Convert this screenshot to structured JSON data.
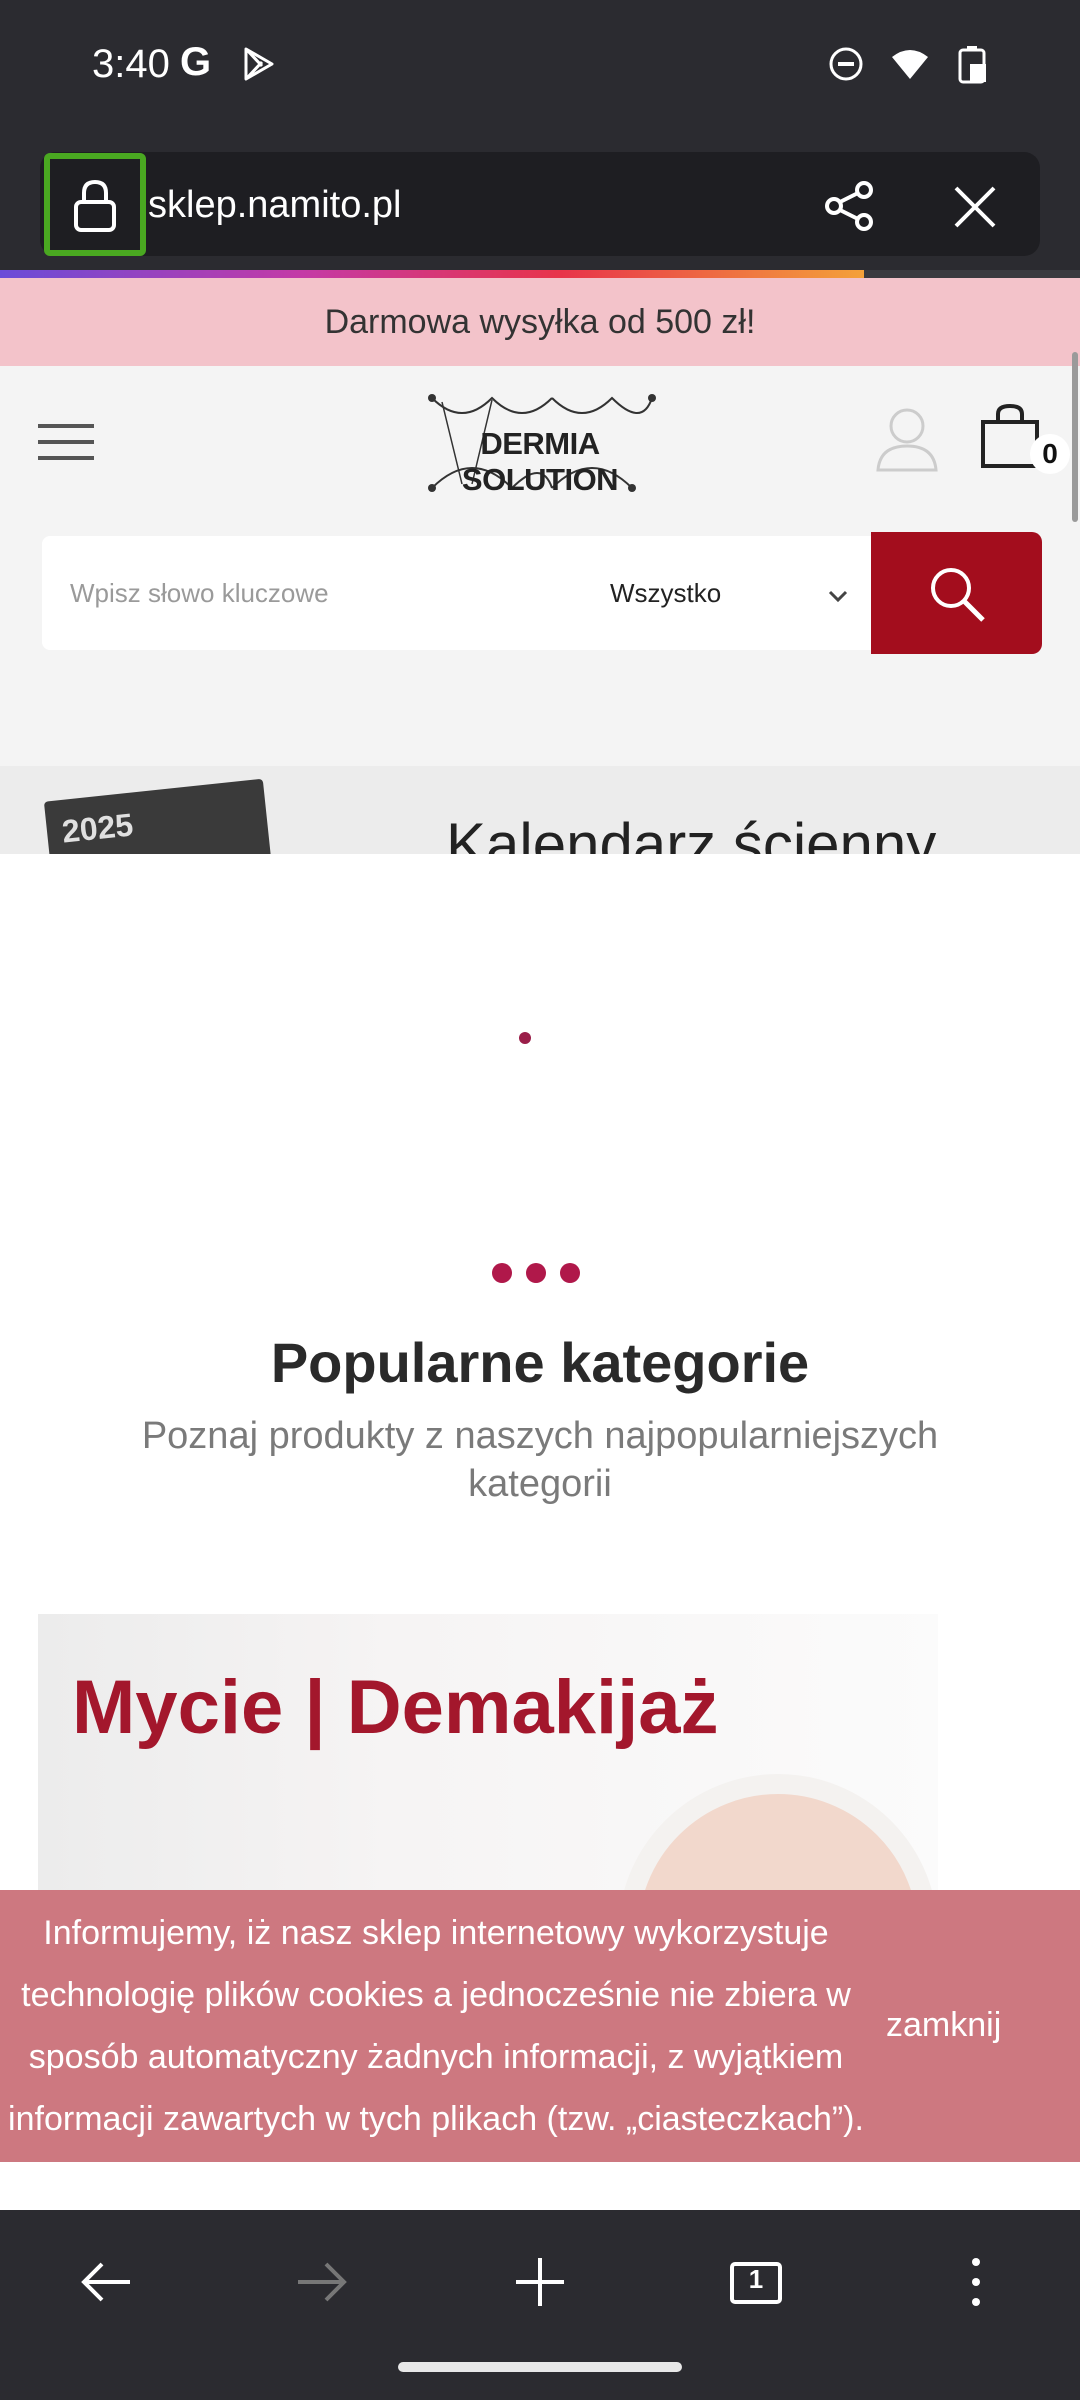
{
  "status_bar": {
    "time": "3:40",
    "g_logo": "G",
    "icons": [
      "google-icon",
      "play-store-icon",
      "dnd-icon",
      "wifi-icon",
      "battery-icon"
    ]
  },
  "browser": {
    "url": "sklep.namito.pl",
    "icons": [
      "lock-icon",
      "share-icon",
      "close-icon"
    ]
  },
  "page": {
    "promo": "Darmowa wysyłka od 500 zł!",
    "logo_text": "DERMIA SOLUTION",
    "cart_count": "0",
    "search": {
      "placeholder": "Wpisz słowo kluczowe",
      "category": "Wszystko"
    },
    "banner": {
      "year": "2025",
      "title": "Kalendarz ścienny"
    },
    "categories": {
      "title": "Popularne kategorie",
      "subtitle": "Poznaj produkty z naszych najpopularniejszych kategorii",
      "first_card_label": "Mycie | Demakijaż"
    },
    "cookie": {
      "text": "Informujemy, iż nasz sklep internetowy wykorzystuje technologię plików cookies a jednocześnie nie zbiera w sposób automatyczny żadnych informacji, z wyjątkiem informacji zawartych w tych plikach (tzw. „ciasteczkach”).",
      "close_label": "zamknij"
    }
  },
  "nav": {
    "tab_count": "1",
    "icons": [
      "back-icon",
      "forward-icon",
      "new-tab-icon",
      "tab-switcher-icon",
      "more-icon"
    ]
  },
  "colors": {
    "accent": "#a30d1d",
    "promo_bg": "#f3c3ca",
    "cookie_bg": "#cd7880",
    "lock_highlight": "#4aa821"
  }
}
